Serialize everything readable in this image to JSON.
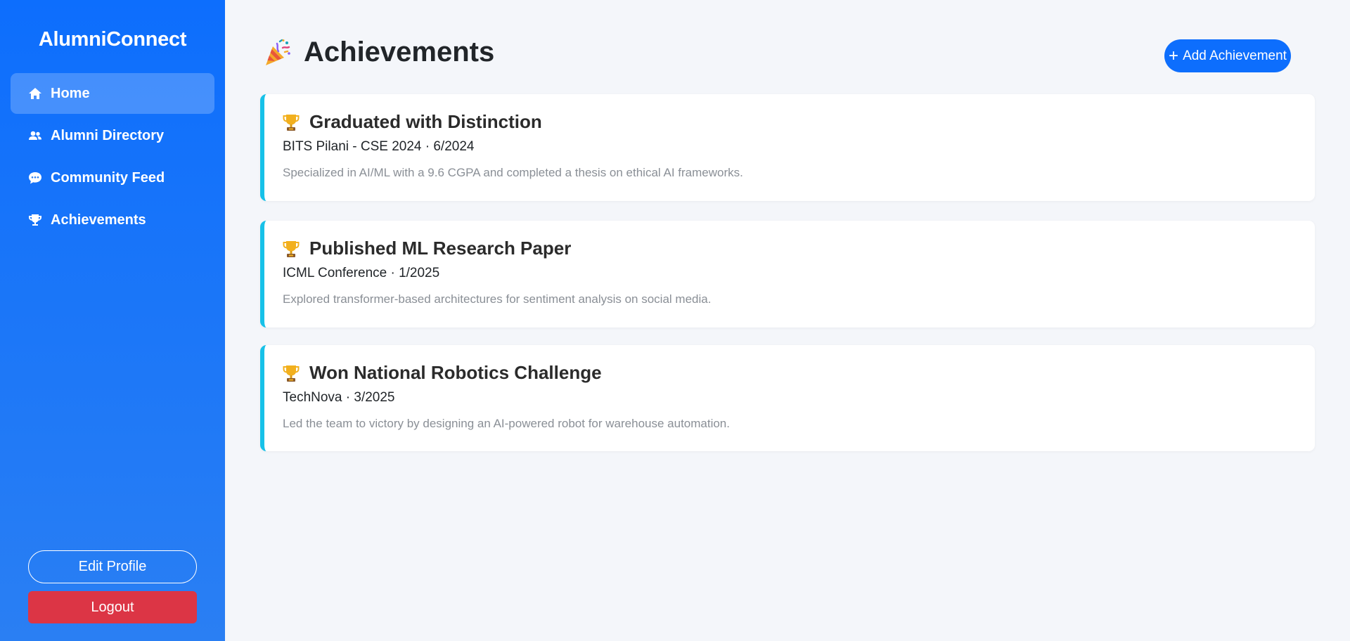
{
  "app": {
    "brand": "AlumniConnect"
  },
  "sidebar": {
    "items": [
      {
        "label": "Home",
        "icon": "home-icon",
        "active": true
      },
      {
        "label": "Alumni Directory",
        "icon": "users-icon"
      },
      {
        "label": "Community Feed",
        "icon": "comment-icon"
      },
      {
        "label": "Achievements",
        "icon": "trophy-icon"
      }
    ],
    "edit_profile_label": "Edit Profile",
    "logout_label": "Logout"
  },
  "header": {
    "title": "Achievements",
    "title_icon": "party-popper-icon",
    "add_label": "Add Achievement"
  },
  "achievements": [
    {
      "title": "Graduated with Distinction",
      "meta": "BITS Pilani - CSE 2024 · 6/2024",
      "description": "Specialized in AI/ML with a 9.6 CGPA and completed a thesis on ethical AI frameworks."
    },
    {
      "title": "Published ML Research Paper",
      "meta": "ICML Conference · 1/2025",
      "description": "Explored transformer-based architectures for sentiment analysis on social media."
    },
    {
      "title": "Won National Robotics Challenge",
      "meta": "TechNova · 3/2025",
      "description": "Led the team to victory by designing an AI-powered robot for warehouse automation."
    }
  ],
  "colors": {
    "primary": "#0d6efd",
    "danger": "#dc3545",
    "card_accent": "#17c1e8",
    "background": "#f4f6fa"
  }
}
